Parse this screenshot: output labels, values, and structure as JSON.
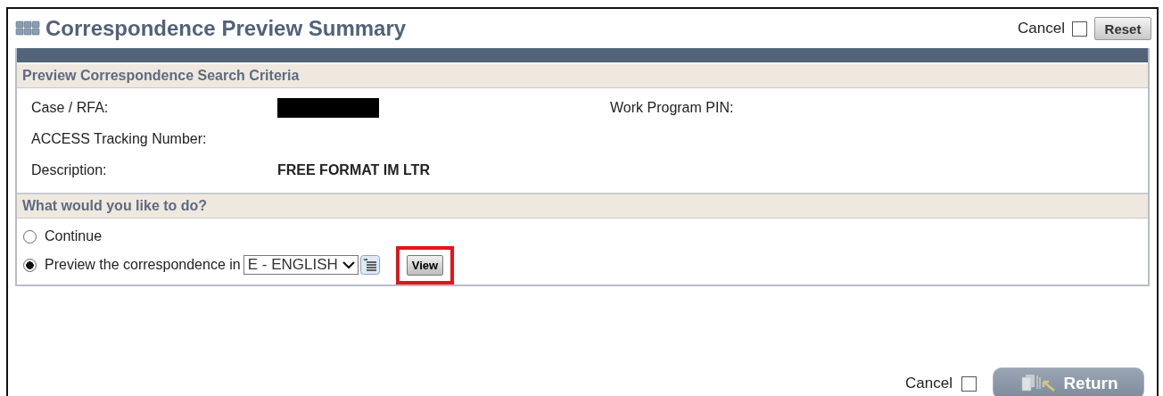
{
  "header": {
    "title": "Correspondence Preview Summary",
    "cancel": {
      "label": "Cancel",
      "checked": false
    },
    "reset": "Reset"
  },
  "criteria": {
    "heading": "Preview Correspondence Search Criteria",
    "fields": [
      {
        "label": "Case / RFA:",
        "redacted": true
      },
      {
        "label": "ACCESS Tracking Number:"
      },
      {
        "label": "Description:",
        "value": "FREE FORMAT IM LTR"
      }
    ],
    "side_field": {
      "label": "Work Program PIN:"
    }
  },
  "actions": {
    "heading": "What would you like to do?",
    "options": [
      {
        "label": "Continue",
        "selected": false
      },
      {
        "label": "Preview the correspondence in",
        "selected": true
      }
    ],
    "language": "E - ENGLISH",
    "view_button": "View",
    "view_highlighted": true
  },
  "footer": {
    "cancel": {
      "label": "Cancel",
      "checked": false
    },
    "return": {
      "label": "Return",
      "disabled": true
    }
  }
}
